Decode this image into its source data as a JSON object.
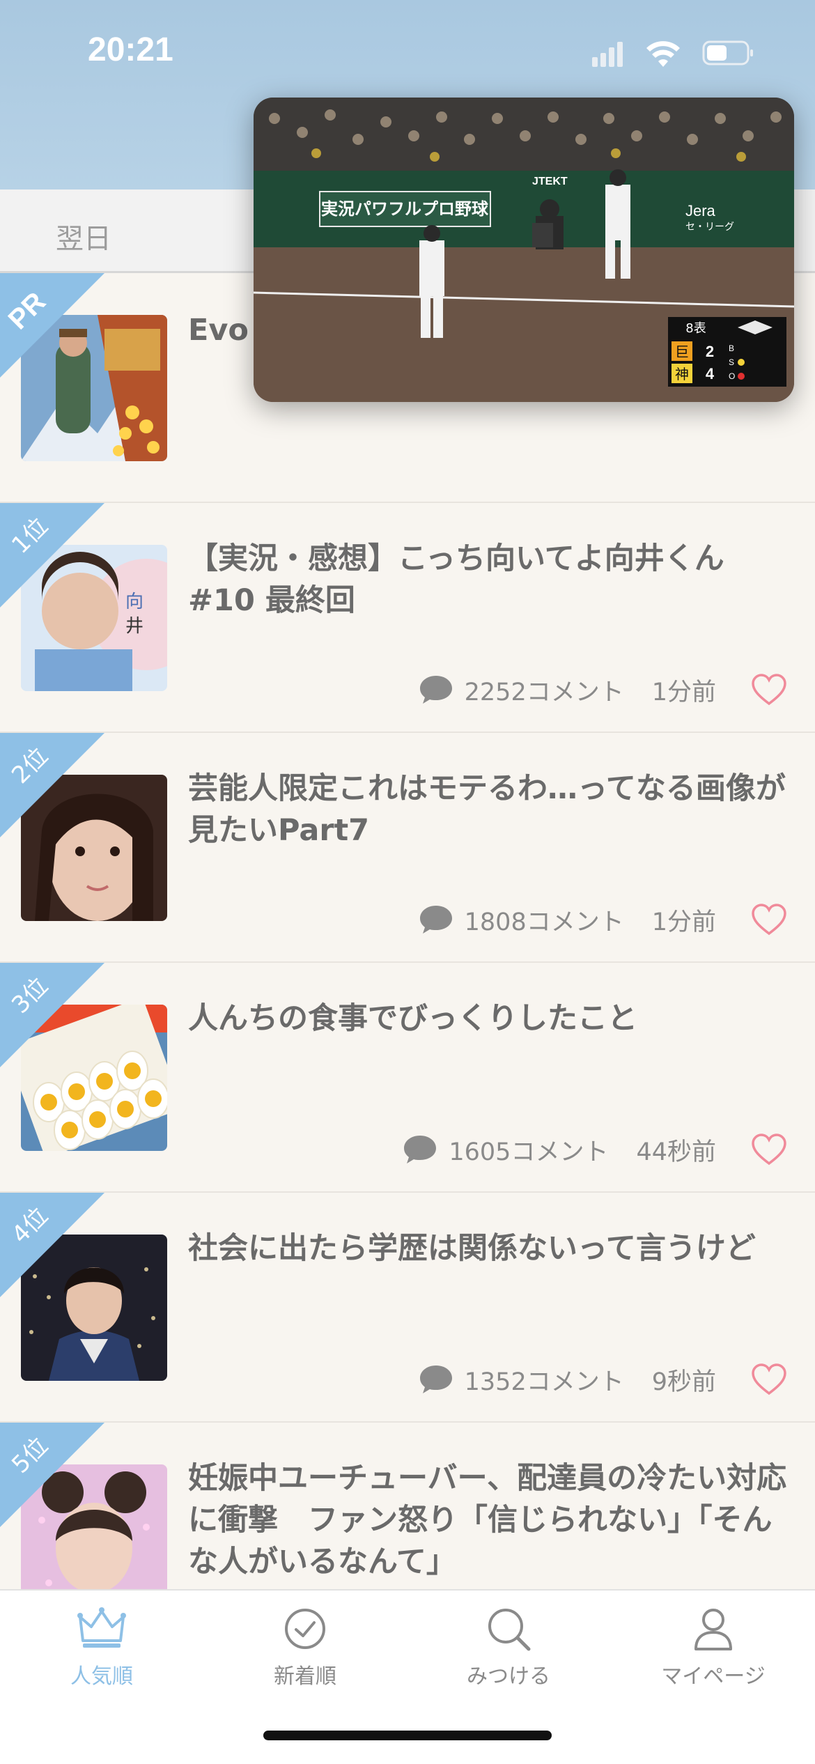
{
  "status_bar": {
    "time": "20:21"
  },
  "top_tab": {
    "label": "翌日"
  },
  "pr_item": {
    "badge": "PR",
    "title": "Evo"
  },
  "ranking": [
    {
      "rank": "1位",
      "title": "【実況・感想】こっち向いてよ向井くん #10 最終回",
      "comments": "2252コメント",
      "time": "1分前"
    },
    {
      "rank": "2位",
      "title": "芸能人限定これはモテるわ…ってなる画像が見たいPart7",
      "comments": "1808コメント",
      "time": "1分前"
    },
    {
      "rank": "3位",
      "title": "人んちの食事でびっくりしたこと",
      "comments": "1605コメント",
      "time": "44秒前"
    },
    {
      "rank": "4位",
      "title": "社会に出たら学歴は関係ないって言うけど",
      "comments": "1352コメント",
      "time": "9秒前"
    },
    {
      "rank": "5位",
      "title": "妊娠中ユーチューバー、配達員の冷たい対応に衝撃　ファン怒り「信じられない」「そんな人がいるなんて」"
    }
  ],
  "pip_video": {
    "banner": "実況パワフルプロ野球",
    "sponsor1": "JTEKT",
    "sponsor2": "Jera",
    "sponsor2_sub": "セ・リーグ",
    "inning": "8表",
    "team1": "巨",
    "score1": "2",
    "team2": "神",
    "score2": "4",
    "bso": [
      "B",
      "S",
      "O"
    ]
  },
  "bottom_nav": [
    {
      "label": "人気順",
      "icon": "crown-icon",
      "active": true
    },
    {
      "label": "新着順",
      "icon": "clock-icon",
      "active": false
    },
    {
      "label": "みつける",
      "icon": "search-icon",
      "active": false
    },
    {
      "label": "マイページ",
      "icon": "person-icon",
      "active": false
    }
  ],
  "colors": {
    "accent": "#8ec0e6",
    "heart": "#f08a9a",
    "ribbon": "#8ec0e6"
  }
}
